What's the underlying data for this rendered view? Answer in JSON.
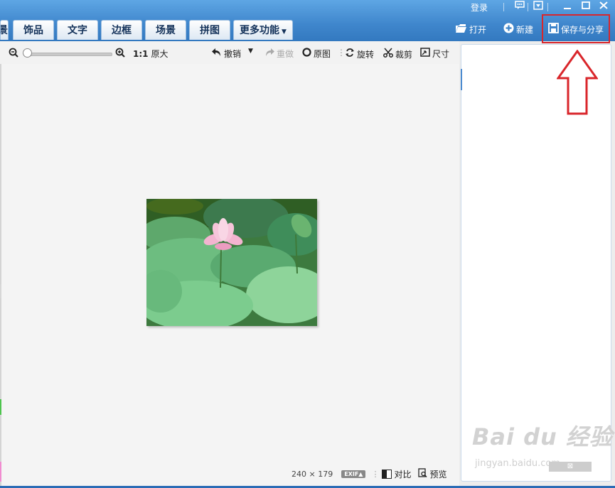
{
  "titlebar": {
    "login": "登录",
    "tabs": [
      "饰品",
      "文字",
      "边框",
      "场景",
      "拼图",
      "更多功能"
    ],
    "cut_tab": "景",
    "open": "打开",
    "new": "新建",
    "save_share": "保存与分享"
  },
  "toolbar": {
    "ratio": "1:1",
    "original_size": "原大",
    "undo": "撤销",
    "redo": "重做",
    "original_image": "原图",
    "rotate": "旋转",
    "crop": "裁剪",
    "size": "尺寸"
  },
  "canvas": {
    "dimensions": "240  ×  179",
    "exif": "EXIF▲",
    "compare": "对比",
    "preview": "预览"
  },
  "watermark": {
    "brand": "Bai du 经验",
    "url": "jingyan.baidu.com"
  },
  "colors": {
    "accent": "#3f86cc",
    "highlight": "#d9262b"
  },
  "icons": [
    "zoom-out-icon",
    "zoom-in-icon",
    "undo-icon",
    "redo-icon",
    "circle-icon",
    "rotate-icon",
    "scissors-icon",
    "resize-icon",
    "folder-icon",
    "plus-icon",
    "save-icon",
    "message-icon",
    "dropdown-icon",
    "minimize-icon",
    "maximize-icon",
    "close-icon",
    "arrow-up-icon"
  ]
}
